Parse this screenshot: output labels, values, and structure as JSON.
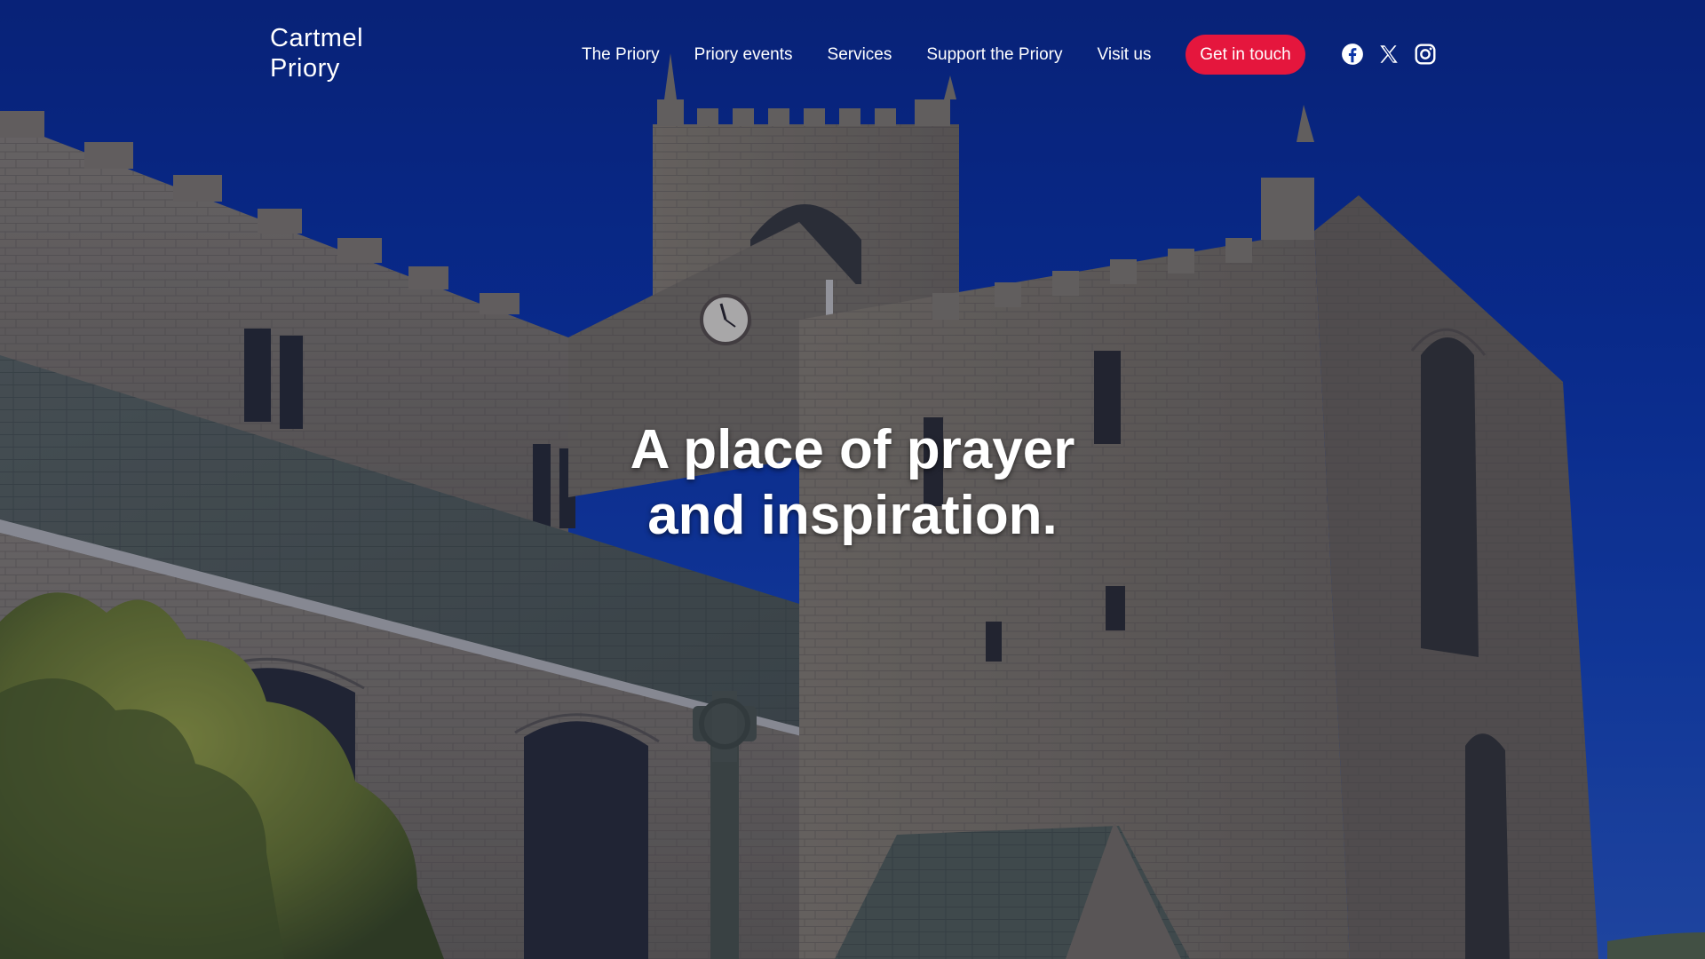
{
  "site": {
    "logo_line1": "Cartmel",
    "logo_line2": "Priory"
  },
  "nav": {
    "items": [
      {
        "label": "The Priory"
      },
      {
        "label": "Priory events"
      },
      {
        "label": "Services"
      },
      {
        "label": "Support the Priory"
      },
      {
        "label": "Visit us"
      }
    ],
    "cta_label": "Get in touch"
  },
  "social": {
    "icons": [
      "facebook-icon",
      "x-icon",
      "instagram-icon"
    ]
  },
  "hero": {
    "headline_line1": "A place of prayer",
    "headline_line2": "and inspiration."
  },
  "colors": {
    "sky": "#0c35a6",
    "cta": "#e5163d",
    "text": "#ffffff"
  }
}
